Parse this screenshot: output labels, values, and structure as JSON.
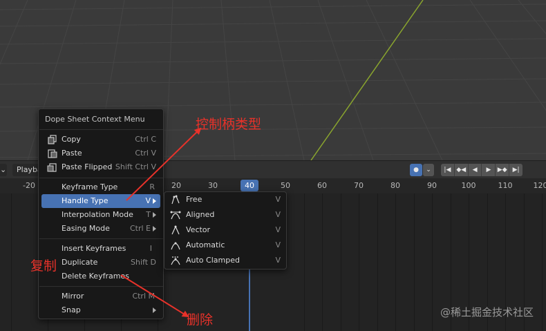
{
  "header": {
    "playback_label": "Playba",
    "playback_controls": [
      "|◀",
      "◆◀",
      "◀",
      "▶",
      "▶◆",
      "▶|"
    ]
  },
  "ruler": {
    "ticks": [
      "-20",
      "20",
      "30",
      "40",
      "50",
      "60",
      "70",
      "80",
      "90",
      "100",
      "110",
      "120"
    ],
    "current_frame": "40"
  },
  "menu": {
    "title": "Dope Sheet Context Menu",
    "items": [
      {
        "label": "Copy",
        "shortcut": "Ctrl C",
        "icon": "copy-icon"
      },
      {
        "label": "Paste",
        "shortcut": "Ctrl V",
        "icon": "paste-icon"
      },
      {
        "label": "Paste Flipped",
        "shortcut": "Shift Ctrl V",
        "icon": "paste-flipped-icon"
      },
      {
        "label": "Keyframe Type",
        "shortcut": "R"
      },
      {
        "label": "Handle Type",
        "shortcut": "V"
      },
      {
        "label": "Interpolation Mode",
        "shortcut": "T"
      },
      {
        "label": "Easing Mode",
        "shortcut": "Ctrl E"
      },
      {
        "label": "Insert Keyframes",
        "shortcut": "I"
      },
      {
        "label": "Duplicate",
        "shortcut": "Shift D"
      },
      {
        "label": "Delete Keyframes",
        "shortcut": ""
      },
      {
        "label": "Mirror",
        "shortcut": "Ctrl M"
      },
      {
        "label": "Snap",
        "shortcut": ""
      }
    ]
  },
  "submenu": {
    "items": [
      {
        "label": "Free",
        "shortcut": "V",
        "icon": "handle-free-icon"
      },
      {
        "label": "Aligned",
        "shortcut": "V",
        "icon": "handle-aligned-icon"
      },
      {
        "label": "Vector",
        "shortcut": "V",
        "icon": "handle-vector-icon"
      },
      {
        "label": "Automatic",
        "shortcut": "V",
        "icon": "handle-auto-icon"
      },
      {
        "label": "Auto Clamped",
        "shortcut": "V",
        "icon": "handle-auto-clamped-icon"
      }
    ]
  },
  "annotations": {
    "handle_type": "控制柄类型",
    "duplicate": "复制",
    "delete": "删除"
  },
  "watermark": "@稀土掘金技术社区",
  "colors": {
    "accent": "#4772b3",
    "annotation": "#e8322a",
    "menu_bg": "#181818"
  }
}
